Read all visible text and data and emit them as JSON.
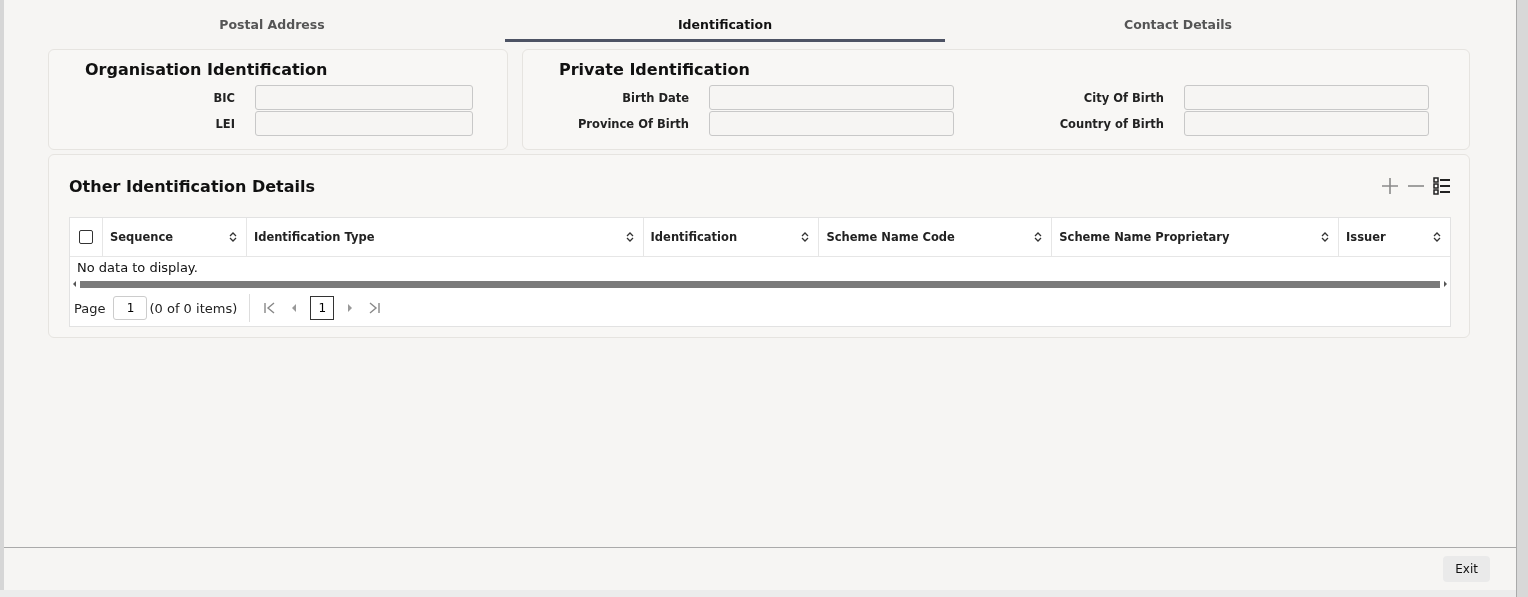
{
  "tabs": [
    {
      "label": "Postal Address",
      "selected": false
    },
    {
      "label": "Identification",
      "selected": true
    },
    {
      "label": "Contact Details",
      "selected": false
    }
  ],
  "organisation": {
    "title": "Organisation Identification",
    "fields": [
      {
        "label": "BIC"
      },
      {
        "label": "LEI"
      }
    ]
  },
  "private": {
    "title": "Private Identification",
    "fields": [
      {
        "label": "Birth Date"
      },
      {
        "label": "City Of Birth"
      },
      {
        "label": "Province Of Birth"
      },
      {
        "label": "Country of Birth"
      }
    ]
  },
  "other": {
    "title": "Other Identification Details",
    "select_all_checked": false,
    "columns": [
      "Sequence",
      "Identification Type",
      "Identification",
      "Scheme Name Code",
      "Scheme Name Proprietary",
      "Issuer"
    ],
    "empty_message": "No data to display.",
    "pagination": {
      "label": "Page",
      "page": "1",
      "summary": "(0 of 0 items)",
      "current": "1"
    }
  },
  "buttons": [
    "Exit"
  ]
}
